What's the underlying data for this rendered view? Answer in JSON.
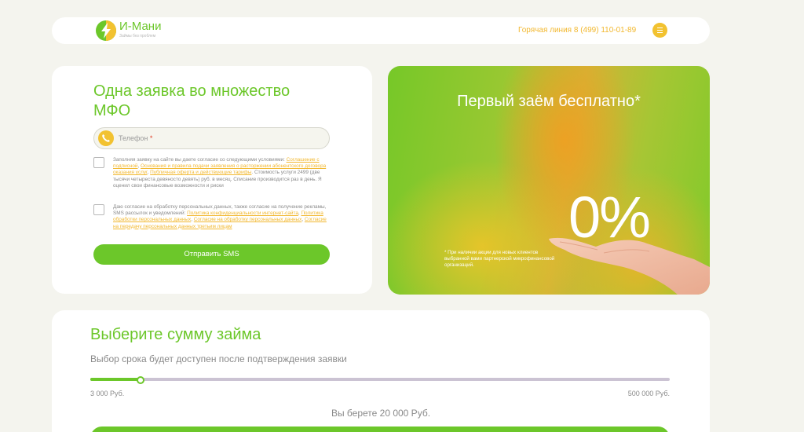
{
  "header": {
    "brand_name": "И-Мани",
    "brand_tagline": "Займы без проблем",
    "hotline": "Горячая линия 8 (499) 110-01-89",
    "logo_icon": "lightning-icon",
    "menu_icon": "hamburger-menu-icon"
  },
  "form": {
    "title": "Одна заявка во множество МФО",
    "phone_placeholder": "Телефон",
    "required_mark": "*",
    "phone_icon": "phone-icon",
    "consent1": {
      "t1": "Заполняя заявку на сайте вы даете согласие со следующими условиями: ",
      "l1": "Соглашение с подписной",
      "s1": ", ",
      "l2": "Основания и правила подачи заявления о расторжении абонентского договора оказания услуг",
      "s2": ", ",
      "l3": "Публичная оферта и действующие тарифы",
      "t2": ". Стоимость услуги 2499 (две тысячи четыреста девяносто девять) руб. в месяц. Списание производится раз в день. Я оценил свои финансовые возможности и риски"
    },
    "consent2": {
      "t1": "Даю согласие на обработку персональных данных, также согласие на получение рекламы, SMS рассылок и уведомлений: ",
      "l1": "Политика конфиденциальности интернет-сайта",
      "s1": ", ",
      "l2": "Политика обработки персональных данных",
      "s2": ", ",
      "l3": "Согласие на обработку персональных данных",
      "s3": ", ",
      "l4": "Согласие на передачу персональных данных третьим лицам"
    },
    "submit_label": "Отправить SMS"
  },
  "promo": {
    "title": "Первый заём бесплатно*",
    "percent": "0%",
    "note": "* При наличии акции для новых клиентов выбранной вами партнерской микрофинансовой организаций."
  },
  "amount": {
    "title": "Выберите сумму займа",
    "subtitle": "Выбор срока будет доступен после подтверждения заявки",
    "min_label": "3 000 Руб.",
    "max_label": "500 000 Руб.",
    "selected_text": "Вы берете 20 000 Руб.",
    "min_value": 3000,
    "max_value": 500000,
    "value": 20000
  },
  "colors": {
    "accent_green": "#6cc72a",
    "accent_yellow": "#f2c230",
    "link": "#f2b830"
  }
}
